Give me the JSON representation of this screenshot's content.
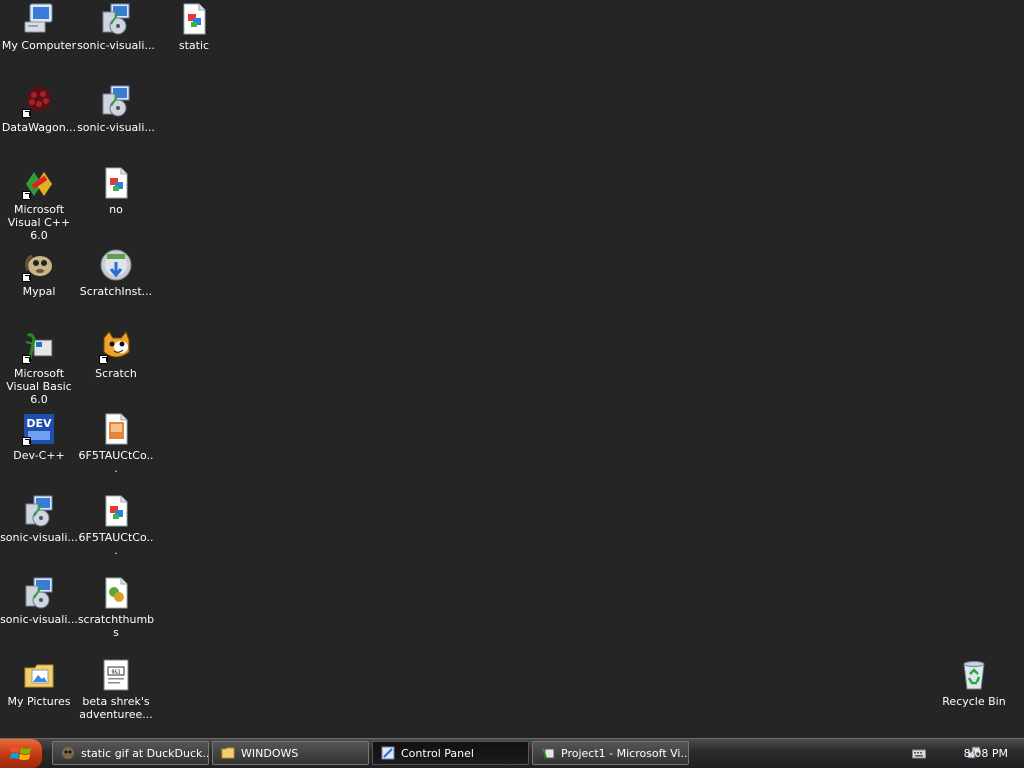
{
  "desktop": {
    "icons": [
      {
        "label": "My Computer",
        "kind": "computer"
      },
      {
        "label": "sonic-visuali...",
        "kind": "installer"
      },
      {
        "label": "static",
        "kind": "image-file"
      },
      {
        "label": "DataWagon...",
        "kind": "datawagon"
      },
      {
        "label": "sonic-visuali...",
        "kind": "installer"
      },
      {
        "label": "Microsoft Visual C++ 6.0",
        "kind": "vcpp"
      },
      {
        "label": "no",
        "kind": "image-file"
      },
      {
        "label": "Mypal",
        "kind": "mypal"
      },
      {
        "label": "ScratchInst...",
        "kind": "disc"
      },
      {
        "label": "Microsoft Visual Basic 6.0",
        "kind": "vb"
      },
      {
        "label": "Scratch",
        "kind": "scratch"
      },
      {
        "label": "Dev-C++",
        "kind": "devcpp"
      },
      {
        "label": "6F5TAUCtCo...",
        "kind": "image-file-orange"
      },
      {
        "label": "sonic-visuali...",
        "kind": "installer"
      },
      {
        "label": "6F5TAUCtCo...",
        "kind": "image-file"
      },
      {
        "label": "sonic-visuali...",
        "kind": "installer"
      },
      {
        "label": "scratchthumbs",
        "kind": "puzzle"
      },
      {
        "label": "My Pictures",
        "kind": "pictures-folder"
      },
      {
        "label": "beta shrek's adventuree...",
        "kind": "document"
      },
      {
        "label": "Recycle Bin",
        "kind": "recycle-bin"
      }
    ]
  },
  "taskbar": {
    "start_label": "start",
    "tasks": [
      {
        "label": "static gif at DuckDuck...",
        "active": false,
        "icon": "browser-icon"
      },
      {
        "label": "WINDOWS",
        "active": false,
        "icon": "folder-icon"
      },
      {
        "label": "Control Panel",
        "active": true,
        "icon": "control-panel-icon"
      },
      {
        "label": "Project1 - Microsoft Vi...",
        "active": false,
        "icon": "vb-project-icon"
      }
    ],
    "tray": {
      "icons": [
        "keyboard-icon",
        "network-icon"
      ],
      "clock": "8:08 PM"
    }
  },
  "colors": {
    "desktop_background": "#252525",
    "start_button": "#c03a12"
  }
}
